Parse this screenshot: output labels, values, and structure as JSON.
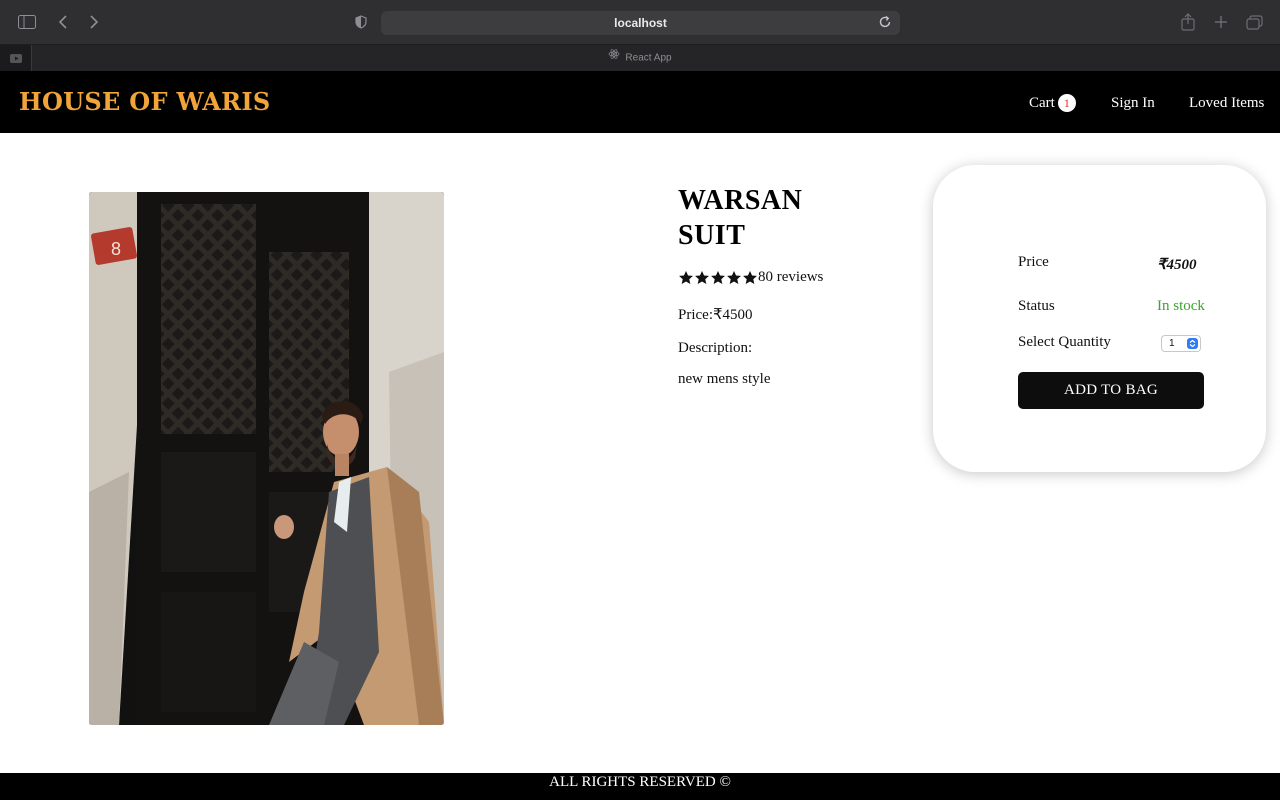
{
  "browser": {
    "url": "localhost",
    "tab_title": "React App",
    "icons": [
      "sidebar-icon",
      "back-icon",
      "forward-icon",
      "privacy-shield-icon",
      "reload-icon",
      "share-icon",
      "new-tab-icon",
      "tab-overview-icon",
      "react-icon"
    ]
  },
  "header": {
    "brand": "HOUSE OF WARIS",
    "cart_label": "Cart",
    "cart_count": "1",
    "signin_label": "Sign In",
    "loved_label": "Loved Items",
    "brand_color": "#f0a43a"
  },
  "product": {
    "title": "WARSAN SUIT",
    "rating_stars": 5,
    "reviews": "80 reviews",
    "price": "Price:₹4500",
    "description_label": "Description:",
    "description": "new mens style"
  },
  "purchase": {
    "price_label": "Price",
    "price_value": "₹4500",
    "status_label": "Status",
    "status_value": "In stock",
    "status_color": "#3aa62e",
    "qty_label": "Select Quantity",
    "qty_value": "1",
    "add_button": "ADD TO BAG"
  },
  "footer": {
    "text": "ALL RIGHTS RESERVED ©"
  }
}
